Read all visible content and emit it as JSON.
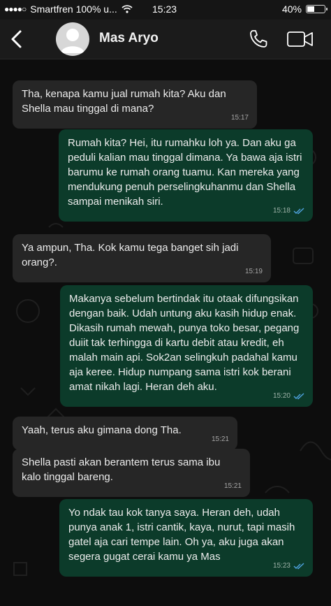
{
  "status_bar": {
    "signal": "●●●●○",
    "carrier": "Smartfren 100% u...",
    "time": "15:23",
    "battery_percent": "40%",
    "battery_level": 0.4
  },
  "header": {
    "contact_name": "Mas Aryo"
  },
  "messages": [
    {
      "direction": "in",
      "text": "Tha, kenapa kamu jual rumah kita? Aku dan Shella mau tinggal di mana?",
      "time": "15:17"
    },
    {
      "direction": "out",
      "text": "Rumah kita? Hei, itu rumahku loh ya. Dan aku ga peduli kalian mau tinggal dimana. Ya bawa aja istri barumu ke rumah orang tuamu. Kan mereka yang mendukung penuh perselingkuhanmu dan Shella sampai menikah siri.",
      "time": "15:18",
      "read": true
    },
    {
      "direction": "in",
      "text": "Ya ampun, Tha. Kok kamu tega banget sih jadi orang?.",
      "time": "15:19"
    },
    {
      "direction": "out",
      "text": "Makanya sebelum bertindak itu otaak difungsikan dengan baik. Udah untung aku kasih hidup enak. Dikasih rumah mewah, punya toko besar, pegang duiit tak terhingga di kartu debit atau kredit, eh malah main api. Sok2an selingkuh padahal kamu aja keree. Hidup numpang sama istri kok berani amat nikah lagi. Heran deh aku.",
      "time": "15:20",
      "read": true
    },
    {
      "direction": "in",
      "text": "Yaah, terus aku gimana dong Tha.",
      "time": "15:21"
    },
    {
      "direction": "in",
      "text": "Shella pasti akan berantem terus sama ibu kalo tinggal bareng.",
      "time": "15:21"
    },
    {
      "direction": "out",
      "text": "Yo ndak tau kok tanya saya. Heran deh, udah punya anak 1, istri cantik, kaya, nurut, tapi masih gatel aja cari tempe lain. Oh ya, aku juga akan segera gugat cerai kamu ya Mas",
      "time": "15:23",
      "read": true
    }
  ],
  "colors": {
    "incoming_bubble": "#262626",
    "outgoing_bubble": "#0c3b2a",
    "read_check": "#4fa3e0"
  }
}
